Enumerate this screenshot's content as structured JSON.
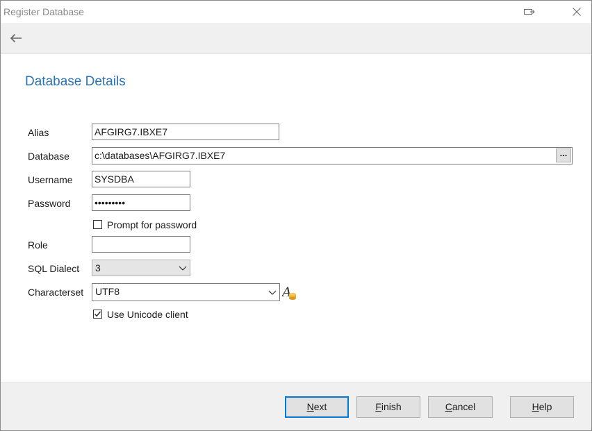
{
  "window": {
    "title": "Register Database"
  },
  "page": {
    "heading": "Database Details"
  },
  "form": {
    "alias": {
      "label": "Alias",
      "value": "AFGIRG7.IBXE7"
    },
    "database": {
      "label": "Database",
      "value": "c:\\databases\\AFGIRG7.IBXE7",
      "browse_label": "..."
    },
    "username": {
      "label": "Username",
      "value": "SYSDBA"
    },
    "password": {
      "label": "Password",
      "value": "•••••••••"
    },
    "prompt_password": {
      "label": "Prompt for password",
      "checked": false
    },
    "role": {
      "label": "Role",
      "value": ""
    },
    "sql_dialect": {
      "label": "SQL Dialect",
      "value": "3"
    },
    "characterset": {
      "label": "Characterset",
      "value": "UTF8"
    },
    "unicode_client": {
      "label": "Use Unicode client",
      "checked": true
    }
  },
  "buttons": {
    "next": {
      "mnemonic": "N",
      "rest": "ext"
    },
    "finish": {
      "mnemonic": "F",
      "rest": "inish"
    },
    "cancel": {
      "mnemonic": "C",
      "rest": "ancel"
    },
    "help": {
      "mnemonic": "H",
      "rest": "elp"
    }
  },
  "colors": {
    "accent": "#2a73b5",
    "default_button_border": "#0078d7"
  }
}
